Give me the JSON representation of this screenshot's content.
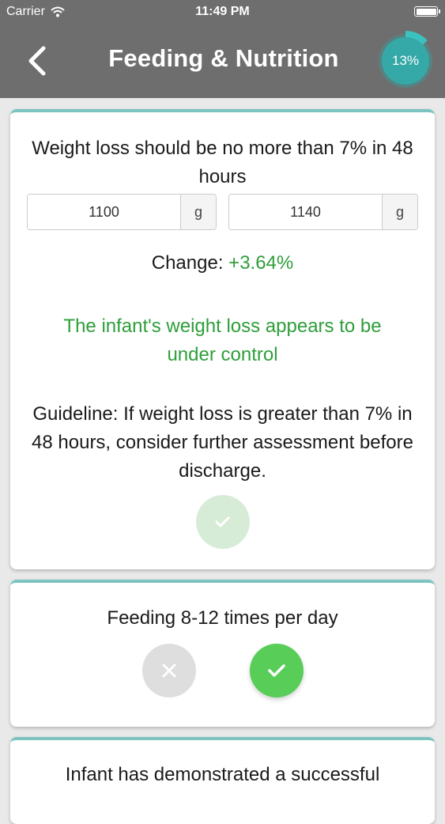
{
  "status_bar": {
    "carrier": "Carrier",
    "time": "11:49 PM"
  },
  "nav": {
    "title": "Feeding & Nutrition",
    "progress_label": "13%",
    "progress_value": 0.13
  },
  "card_weight": {
    "question": "Weight loss should be no more than 7% in 48 hours",
    "weight1": {
      "value": "1100",
      "unit": "g"
    },
    "weight2": {
      "value": "1140",
      "unit": "g"
    },
    "change_label": "Change:",
    "change_value": "+3.64%",
    "status_message": "The infant's weight loss appears to be under control",
    "guideline": "Guideline: If weight loss is greater than 7% in 48 hours, consider further assessment before discharge."
  },
  "card_feeding": {
    "question": "Feeding 8-12 times per day"
  },
  "card_latch": {
    "question": "Infant has demonstrated a successful"
  },
  "colors": {
    "header": "#6e6e6e",
    "accent_teal": "#7cc4c2",
    "progress_ring": "#2fa8a6",
    "success_green": "#2e9e3a",
    "yes_button": "#58cd58",
    "no_button": "#dedede"
  },
  "icons": {
    "wifi": "wifi-icon",
    "battery": "battery-icon",
    "back": "chevron-left-icon",
    "check": "checkmark-icon",
    "cross": "x-icon"
  }
}
